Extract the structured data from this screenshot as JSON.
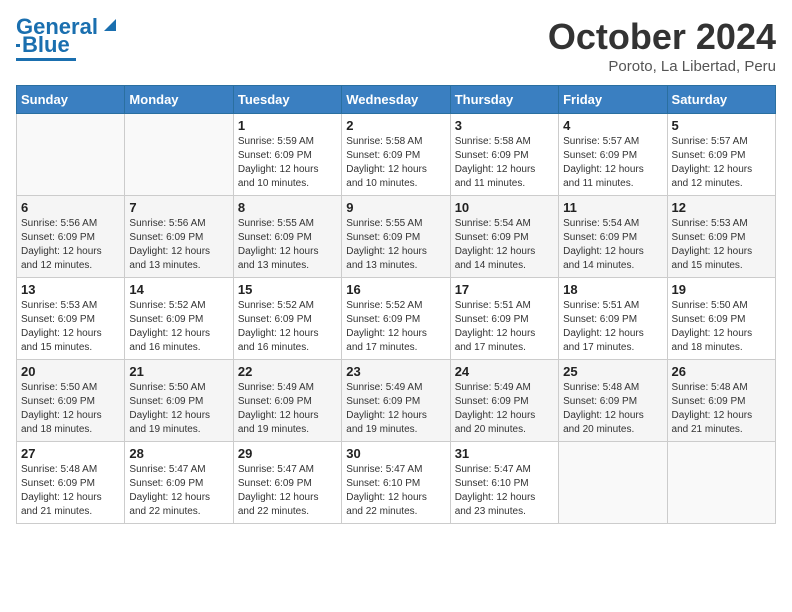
{
  "logo": {
    "text1": "General",
    "text2": "Blue"
  },
  "title": "October 2024",
  "location": "Poroto, La Libertad, Peru",
  "headers": [
    "Sunday",
    "Monday",
    "Tuesday",
    "Wednesday",
    "Thursday",
    "Friday",
    "Saturday"
  ],
  "weeks": [
    [
      {
        "day": "",
        "info": ""
      },
      {
        "day": "",
        "info": ""
      },
      {
        "day": "1",
        "info": "Sunrise: 5:59 AM\nSunset: 6:09 PM\nDaylight: 12 hours and 10 minutes."
      },
      {
        "day": "2",
        "info": "Sunrise: 5:58 AM\nSunset: 6:09 PM\nDaylight: 12 hours and 10 minutes."
      },
      {
        "day": "3",
        "info": "Sunrise: 5:58 AM\nSunset: 6:09 PM\nDaylight: 12 hours and 11 minutes."
      },
      {
        "day": "4",
        "info": "Sunrise: 5:57 AM\nSunset: 6:09 PM\nDaylight: 12 hours and 11 minutes."
      },
      {
        "day": "5",
        "info": "Sunrise: 5:57 AM\nSunset: 6:09 PM\nDaylight: 12 hours and 12 minutes."
      }
    ],
    [
      {
        "day": "6",
        "info": "Sunrise: 5:56 AM\nSunset: 6:09 PM\nDaylight: 12 hours and 12 minutes."
      },
      {
        "day": "7",
        "info": "Sunrise: 5:56 AM\nSunset: 6:09 PM\nDaylight: 12 hours and 13 minutes."
      },
      {
        "day": "8",
        "info": "Sunrise: 5:55 AM\nSunset: 6:09 PM\nDaylight: 12 hours and 13 minutes."
      },
      {
        "day": "9",
        "info": "Sunrise: 5:55 AM\nSunset: 6:09 PM\nDaylight: 12 hours and 13 minutes."
      },
      {
        "day": "10",
        "info": "Sunrise: 5:54 AM\nSunset: 6:09 PM\nDaylight: 12 hours and 14 minutes."
      },
      {
        "day": "11",
        "info": "Sunrise: 5:54 AM\nSunset: 6:09 PM\nDaylight: 12 hours and 14 minutes."
      },
      {
        "day": "12",
        "info": "Sunrise: 5:53 AM\nSunset: 6:09 PM\nDaylight: 12 hours and 15 minutes."
      }
    ],
    [
      {
        "day": "13",
        "info": "Sunrise: 5:53 AM\nSunset: 6:09 PM\nDaylight: 12 hours and 15 minutes."
      },
      {
        "day": "14",
        "info": "Sunrise: 5:52 AM\nSunset: 6:09 PM\nDaylight: 12 hours and 16 minutes."
      },
      {
        "day": "15",
        "info": "Sunrise: 5:52 AM\nSunset: 6:09 PM\nDaylight: 12 hours and 16 minutes."
      },
      {
        "day": "16",
        "info": "Sunrise: 5:52 AM\nSunset: 6:09 PM\nDaylight: 12 hours and 17 minutes."
      },
      {
        "day": "17",
        "info": "Sunrise: 5:51 AM\nSunset: 6:09 PM\nDaylight: 12 hours and 17 minutes."
      },
      {
        "day": "18",
        "info": "Sunrise: 5:51 AM\nSunset: 6:09 PM\nDaylight: 12 hours and 17 minutes."
      },
      {
        "day": "19",
        "info": "Sunrise: 5:50 AM\nSunset: 6:09 PM\nDaylight: 12 hours and 18 minutes."
      }
    ],
    [
      {
        "day": "20",
        "info": "Sunrise: 5:50 AM\nSunset: 6:09 PM\nDaylight: 12 hours and 18 minutes."
      },
      {
        "day": "21",
        "info": "Sunrise: 5:50 AM\nSunset: 6:09 PM\nDaylight: 12 hours and 19 minutes."
      },
      {
        "day": "22",
        "info": "Sunrise: 5:49 AM\nSunset: 6:09 PM\nDaylight: 12 hours and 19 minutes."
      },
      {
        "day": "23",
        "info": "Sunrise: 5:49 AM\nSunset: 6:09 PM\nDaylight: 12 hours and 19 minutes."
      },
      {
        "day": "24",
        "info": "Sunrise: 5:49 AM\nSunset: 6:09 PM\nDaylight: 12 hours and 20 minutes."
      },
      {
        "day": "25",
        "info": "Sunrise: 5:48 AM\nSunset: 6:09 PM\nDaylight: 12 hours and 20 minutes."
      },
      {
        "day": "26",
        "info": "Sunrise: 5:48 AM\nSunset: 6:09 PM\nDaylight: 12 hours and 21 minutes."
      }
    ],
    [
      {
        "day": "27",
        "info": "Sunrise: 5:48 AM\nSunset: 6:09 PM\nDaylight: 12 hours and 21 minutes."
      },
      {
        "day": "28",
        "info": "Sunrise: 5:47 AM\nSunset: 6:09 PM\nDaylight: 12 hours and 22 minutes."
      },
      {
        "day": "29",
        "info": "Sunrise: 5:47 AM\nSunset: 6:09 PM\nDaylight: 12 hours and 22 minutes."
      },
      {
        "day": "30",
        "info": "Sunrise: 5:47 AM\nSunset: 6:10 PM\nDaylight: 12 hours and 22 minutes."
      },
      {
        "day": "31",
        "info": "Sunrise: 5:47 AM\nSunset: 6:10 PM\nDaylight: 12 hours and 23 minutes."
      },
      {
        "day": "",
        "info": ""
      },
      {
        "day": "",
        "info": ""
      }
    ]
  ]
}
